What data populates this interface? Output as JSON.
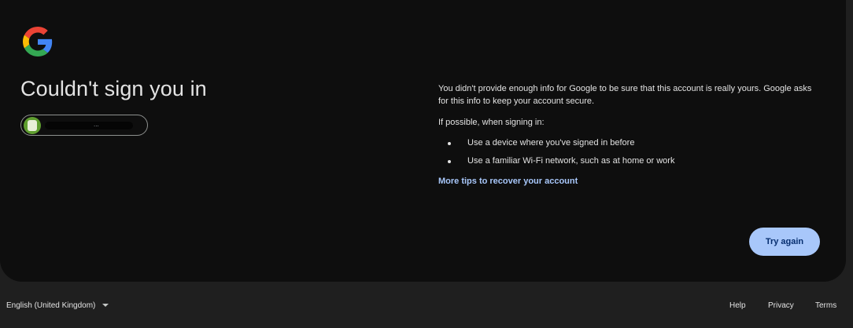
{
  "card": {
    "logo_icon": "google-g-logo-icon",
    "title": "Couldn't sign you in",
    "account_chip": {
      "avatar_icon": "account-avatar-icon",
      "email_redacted_tail": "..."
    },
    "message": {
      "paragraph1": "You didn't provide enough info for Google to be sure that this account is really yours. Google asks for this info to keep your account secure.",
      "paragraph2": "If possible, when signing in:",
      "tips": [
        "Use a device where you've signed in before",
        "Use a familiar Wi-Fi network, such as at home or work"
      ],
      "more_tips_link": "More tips to recover your account"
    },
    "try_again_label": "Try again"
  },
  "footer": {
    "language": "English (United Kingdom)",
    "language_dropdown_icon": "caret-down-icon",
    "help": "Help",
    "privacy": "Privacy",
    "terms": "Terms"
  },
  "colors": {
    "page_bg": "#1f1f1f",
    "card_bg": "#0e0e0e",
    "accent": "#a8c7fa",
    "button_text": "#062e6f",
    "google_blue": "#4285f4",
    "google_red": "#ea4335",
    "google_yellow": "#fbbc05",
    "google_green": "#34a853"
  }
}
